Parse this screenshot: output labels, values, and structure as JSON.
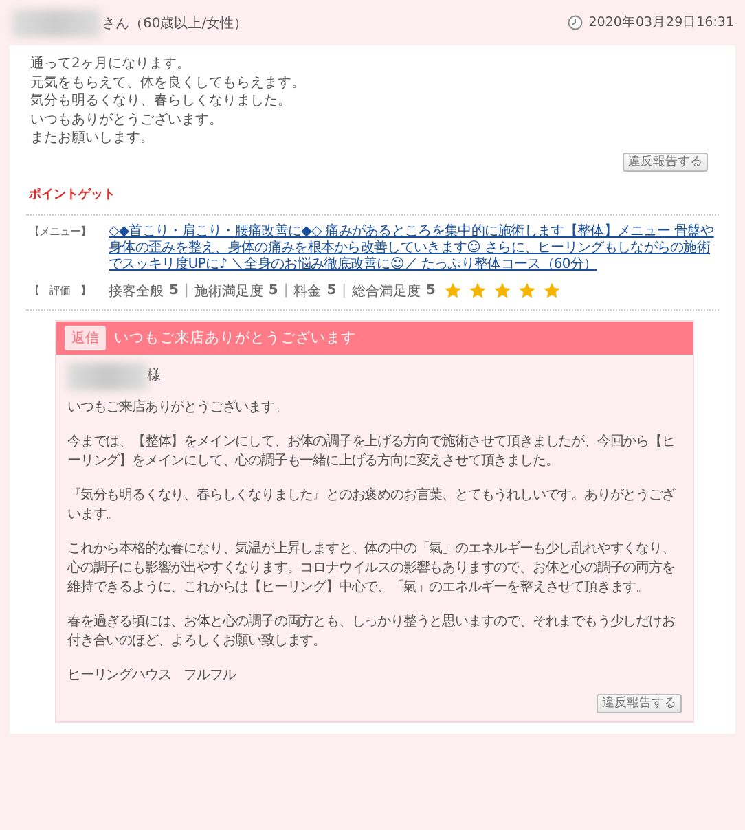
{
  "reviewer": {
    "suffix": "さん（60歳以上/女性）"
  },
  "posted_at": "2020年03月29日16:31",
  "review": {
    "lines": [
      "通って2ヶ月になります。",
      "元気をもらえて、体を良くしてもらえます。",
      "気分も明るくなり、春らしくなりました。",
      "いつもありがとうございます。",
      "またお願いします。"
    ]
  },
  "report_button": "違反報告する",
  "point_label": "ポイントゲット",
  "menu": {
    "label": "【メニュー】",
    "link": "◇◆首こり・肩こり・腰痛改善に◆◇ 痛みがあるところを集中的に施術します【整体】メニュー 骨盤や身体の歪みを整え、身体の痛みを根本から改善していきます☺ さらに、ヒーリングもしながらの施術でスッキリ度UPに♪ ＼全身のお悩み徹底改善に☺／ たっぷり整体コース（60分）"
  },
  "rating": {
    "label": "【　評価　】",
    "separator": "|",
    "stars": 5,
    "items": [
      {
        "name": "接客全般",
        "value": "5"
      },
      {
        "name": "施術満足度",
        "value": "5"
      },
      {
        "name": "料金",
        "value": "5"
      },
      {
        "name": "総合満足度",
        "value": "5"
      }
    ]
  },
  "reply": {
    "badge": "返信",
    "title": "いつもご来店ありがとうございます",
    "salutation": "様",
    "paragraphs": [
      "いつもご来店ありがとうございます。",
      "今までは、【整体】をメインにして、お体の調子を上げる方向で施術させて頂きましたが、今回から【ヒーリング】をメインにして、心の調子も一緒に上げる方向に変えさせて頂きました。",
      "『気分も明るくなり、春らしくなりました』とのお褒めのお言葉、とてもうれしいです。ありがとうございます。",
      "これから本格的な春になり、気温が上昇しますと、体の中の「氣」のエネルギーも少し乱れやすくなり、心の調子にも影響が出やすくなります。コロナウイルスの影響もありますので、お体と心の調子の両方を維持できるように、これからは【ヒーリング】中心で、「氣」のエネルギーを整えさせて頂きます。",
      "春を過ぎる頃には、お体と心の調子の両方とも、しっかり整うと思いますので、それまでもう少しだけお付き合いのほど、よろしくお願い致します。",
      "ヒーリングハウス　フルフル"
    ],
    "report_button": "違反報告する"
  }
}
